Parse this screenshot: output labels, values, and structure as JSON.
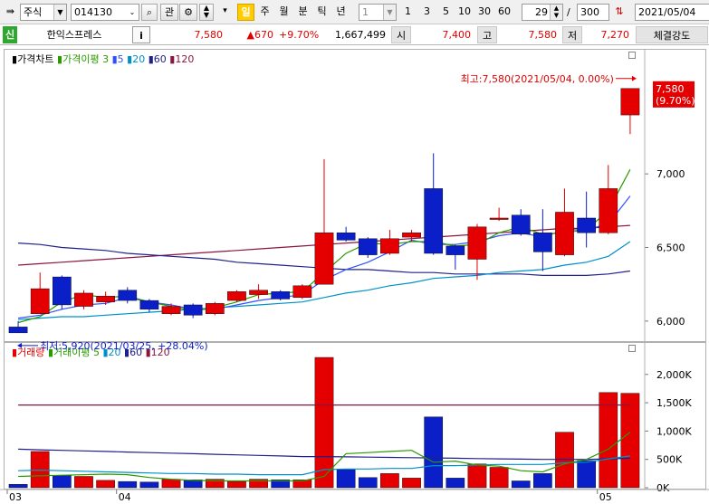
{
  "toolbar": {
    "market": "주식",
    "code": "014130",
    "btn_search": "⌕",
    "btn_kwan": "관",
    "period_tabs": [
      "일",
      "주",
      "월",
      "분",
      "틱",
      "년"
    ],
    "interval_value": "1",
    "quick_intervals": [
      "1",
      "3",
      "5",
      "10",
      "30",
      "60"
    ],
    "count_value": "29",
    "slash": "/",
    "total_value": "300",
    "date_value": "2021/05/04"
  },
  "quote": {
    "badge": "신",
    "name": "한익스프레스",
    "info": "i",
    "price": "7,580",
    "change": "▲670",
    "rate": "+9.70%",
    "volume": "1,667,499",
    "open_label": "시",
    "open": "7,400",
    "high_label": "고",
    "high": "7,580",
    "low_label": "저",
    "low": "7,270",
    "strength_label": "체결강도"
  },
  "price_panel": {
    "legend": {
      "main": "가격차트",
      "ma_label": "가격이평",
      "ma_periods": [
        "3",
        "5",
        "20",
        "60",
        "120"
      ]
    },
    "y_ticks": [
      "7,000",
      "6,500",
      "6,000"
    ],
    "current_box": [
      "7,580",
      "(9.70%)"
    ],
    "high_note": "최고:7,580(2021/05/04, 0.00%)",
    "low_note": "최저:5,920(2021/03/25, +28.04%)"
  },
  "volume_panel": {
    "legend": {
      "main": "거래량",
      "ma_label": "거래이평",
      "ma_periods": [
        "5",
        "20",
        "60",
        "120"
      ]
    },
    "y_ticks": [
      "2,000K",
      "1,500K",
      "1,000K",
      "500K",
      "0K"
    ]
  },
  "x_ticks": [
    "03",
    "04",
    "05"
  ],
  "colors": {
    "up": "#e40000",
    "down": "#0a1fc8",
    "ma3": "#2a9a00",
    "ma5": "#3050ff",
    "ma20": "#0090c8",
    "ma60": "#20208c",
    "ma120": "#8c1440"
  },
  "chart_data": {
    "type": "candlestick",
    "candles": [
      {
        "open": 5960,
        "close": 5920,
        "high": 6000,
        "low": 5920
      },
      {
        "open": 6050,
        "close": 6220,
        "high": 6330,
        "low": 6050
      },
      {
        "open": 6300,
        "close": 6110,
        "high": 6310,
        "low": 6080
      },
      {
        "open": 6100,
        "close": 6190,
        "high": 6210,
        "low": 6080
      },
      {
        "open": 6130,
        "close": 6170,
        "high": 6200,
        "low": 6110
      },
      {
        "open": 6210,
        "close": 6140,
        "high": 6230,
        "low": 6120
      },
      {
        "open": 6140,
        "close": 6080,
        "high": 6150,
        "low": 6060
      },
      {
        "open": 6050,
        "close": 6100,
        "high": 6120,
        "low": 6040
      },
      {
        "open": 6110,
        "close": 6040,
        "high": 6120,
        "low": 6020
      },
      {
        "open": 6050,
        "close": 6120,
        "high": 6130,
        "low": 6040
      },
      {
        "open": 6140,
        "close": 6200,
        "high": 6210,
        "low": 6130
      },
      {
        "open": 6180,
        "close": 6210,
        "high": 6250,
        "low": 6150
      },
      {
        "open": 6200,
        "close": 6150,
        "high": 6210,
        "low": 6140
      },
      {
        "open": 6160,
        "close": 6240,
        "high": 6250,
        "low": 6150
      },
      {
        "open": 6250,
        "close": 6600,
        "high": 7100,
        "low": 6250
      },
      {
        "open": 6600,
        "close": 6550,
        "high": 6640,
        "low": 6540
      },
      {
        "open": 6560,
        "close": 6450,
        "high": 6570,
        "low": 6430
      },
      {
        "open": 6460,
        "close": 6560,
        "high": 6620,
        "low": 6450
      },
      {
        "open": 6570,
        "close": 6600,
        "high": 6620,
        "low": 6540
      },
      {
        "open": 6900,
        "close": 6460,
        "high": 7140,
        "low": 6450
      },
      {
        "open": 6510,
        "close": 6450,
        "high": 6520,
        "low": 6350
      },
      {
        "open": 6420,
        "close": 6640,
        "high": 6660,
        "low": 6280
      },
      {
        "open": 6690,
        "close": 6700,
        "high": 6770,
        "low": 6680
      },
      {
        "open": 6720,
        "close": 6590,
        "high": 6760,
        "low": 6580
      },
      {
        "open": 6600,
        "close": 6470,
        "high": 6760,
        "low": 6340
      },
      {
        "open": 6450,
        "close": 6740,
        "high": 6900,
        "low": 6440
      },
      {
        "open": 6700,
        "close": 6600,
        "high": 6880,
        "low": 6500
      },
      {
        "open": 6600,
        "close": 6900,
        "high": 7060,
        "low": 6590
      },
      {
        "open": 7400,
        "close": 7580,
        "high": 7580,
        "low": 7270
      }
    ],
    "volume": [
      60,
      640,
      220,
      200,
      130,
      110,
      100,
      150,
      140,
      150,
      110,
      150,
      140,
      140,
      2300,
      320,
      180,
      250,
      170,
      1250,
      170,
      420,
      360,
      120,
      250,
      980,
      480,
      1680,
      1667
    ],
    "ma3": [
      5990,
      6030,
      6130,
      6180,
      6160,
      6170,
      6130,
      6100,
      6070,
      6090,
      6130,
      6180,
      6190,
      6200,
      6330,
      6460,
      6530,
      6520,
      6540,
      6540,
      6510,
      6520,
      6600,
      6640,
      6590,
      6600,
      6620,
      6750,
      7030
    ],
    "ma5": [
      6020,
      6040,
      6080,
      6110,
      6120,
      6160,
      6130,
      6110,
      6080,
      6080,
      6110,
      6140,
      6160,
      6180,
      6280,
      6350,
      6400,
      6470,
      6550,
      6520,
      6520,
      6540,
      6580,
      6600,
      6570,
      6620,
      6620,
      6660,
      6850
    ],
    "ma20": [
      6010,
      6020,
      6030,
      6030,
      6040,
      6050,
      6060,
      6070,
      6080,
      6090,
      6100,
      6110,
      6120,
      6130,
      6160,
      6190,
      6210,
      6240,
      6260,
      6290,
      6300,
      6310,
      6330,
      6340,
      6350,
      6380,
      6400,
      6440,
      6540
    ],
    "ma60": [
      6530,
      6520,
      6500,
      6490,
      6480,
      6460,
      6450,
      6440,
      6430,
      6420,
      6400,
      6390,
      6380,
      6370,
      6360,
      6350,
      6350,
      6340,
      6330,
      6330,
      6320,
      6320,
      6320,
      6320,
      6310,
      6310,
      6310,
      6320,
      6340
    ],
    "ma120": [
      6380,
      6390,
      6400,
      6410,
      6420,
      6430,
      6440,
      6450,
      6460,
      6470,
      6480,
      6490,
      6500,
      6510,
      6520,
      6530,
      6540,
      6550,
      6560,
      6570,
      6580,
      6590,
      6600,
      6610,
      6620,
      6630,
      6630,
      6640,
      6650
    ],
    "vol_ma5": [
      200,
      210,
      220,
      230,
      240,
      230,
      180,
      150,
      130,
      120,
      120,
      120,
      120,
      120,
      200,
      600,
      620,
      640,
      660,
      450,
      470,
      400,
      380,
      300,
      280,
      420,
      500,
      680,
      980
    ],
    "vol_ma20": [
      300,
      310,
      300,
      290,
      280,
      270,
      260,
      250,
      250,
      240,
      240,
      230,
      230,
      230,
      320,
      330,
      330,
      340,
      340,
      390,
      390,
      400,
      410,
      410,
      410,
      440,
      450,
      510,
      560
    ],
    "vol_ma60": [
      680,
      670,
      660,
      650,
      640,
      630,
      620,
      610,
      600,
      590,
      580,
      570,
      560,
      550,
      550,
      545,
      540,
      535,
      530,
      525,
      520,
      515,
      510,
      505,
      500,
      500,
      500,
      510,
      520
    ],
    "vol_ma120": [
      1460,
      1460,
      1460,
      1460,
      1460,
      1460,
      1460,
      1460,
      1460,
      1460,
      1460,
      1460,
      1460,
      1460,
      1460,
      1460,
      1460,
      1460,
      1460,
      1460,
      1460,
      1460,
      1460,
      1460,
      1460,
      1460,
      1460,
      1460,
      1460
    ],
    "x_tick_index": {
      "03": 0,
      "04": 5,
      "05": 27
    },
    "price_ylim": [
      5870,
      7800
    ],
    "volume_ylim": [
      0,
      2300
    ]
  }
}
